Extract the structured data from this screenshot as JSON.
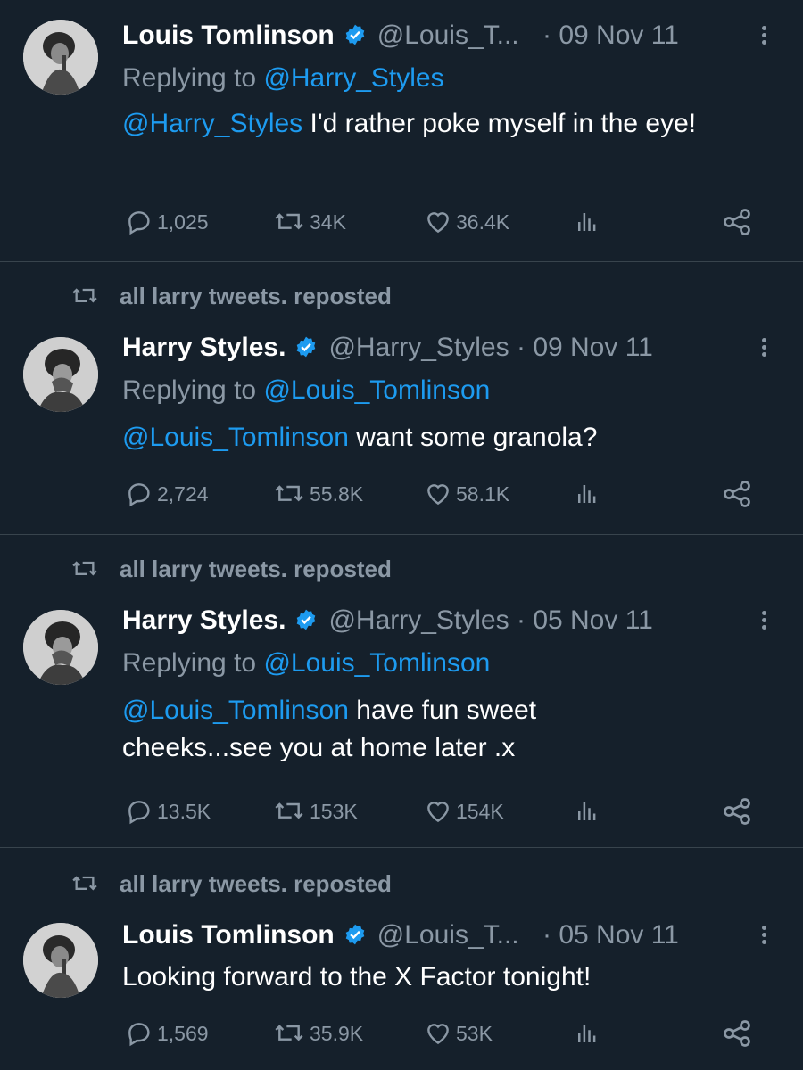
{
  "tweets": [
    {
      "reposted_by": "",
      "name": "Louis Tomlinson",
      "handle": "@Louis_T...",
      "separator": "·",
      "date": "09 Nov 11",
      "reply_prefix": "Replying to ",
      "reply_to": "@Harry_Styles",
      "mention": "@Harry_Styles",
      "text": " I'd rather poke myself in the eye!",
      "replies": "1,025",
      "reposts": "34K",
      "likes": "36.4K"
    },
    {
      "reposted_by": "all larry tweets. reposted",
      "name": "Harry Styles.",
      "handle": "@Harry_Styles",
      "separator": "·",
      "date": "09 Nov 11",
      "reply_prefix": "Replying to ",
      "reply_to": "@Louis_Tomlinson",
      "mention": "@Louis_Tomlinson",
      "text": " want some granola?",
      "replies": "2,724",
      "reposts": "55.8K",
      "likes": "58.1K"
    },
    {
      "reposted_by": "all larry tweets. reposted",
      "name": "Harry Styles.",
      "handle": "@Harry_Styles",
      "separator": "·",
      "date": "05 Nov 11",
      "reply_prefix": "Replying to ",
      "reply_to": "@Louis_Tomlinson",
      "mention": "@Louis_Tomlinson",
      "text": " have fun sweet cheeks...see you at home later .x",
      "replies": "13.5K",
      "reposts": "153K",
      "likes": "154K"
    },
    {
      "reposted_by": "all larry tweets. reposted",
      "name": "Louis Tomlinson",
      "handle": "@Louis_T...",
      "separator": "·",
      "date": "05 Nov 11",
      "reply_prefix": "",
      "reply_to": "",
      "mention": "",
      "text": "Looking forward to the X Factor tonight!",
      "replies": "1,569",
      "reposts": "35.9K",
      "likes": "53K"
    }
  ],
  "icons": {
    "reply": "reply-icon",
    "repost": "repost-icon",
    "like": "heart-icon",
    "views": "views-icon",
    "share": "share-icon",
    "verified": "verified-badge-icon",
    "more": "more-icon"
  },
  "colors": {
    "background": "#15202b",
    "link": "#1d9bf0",
    "muted": "#8b98a5",
    "text": "#ffffff",
    "divider": "#38444d"
  }
}
